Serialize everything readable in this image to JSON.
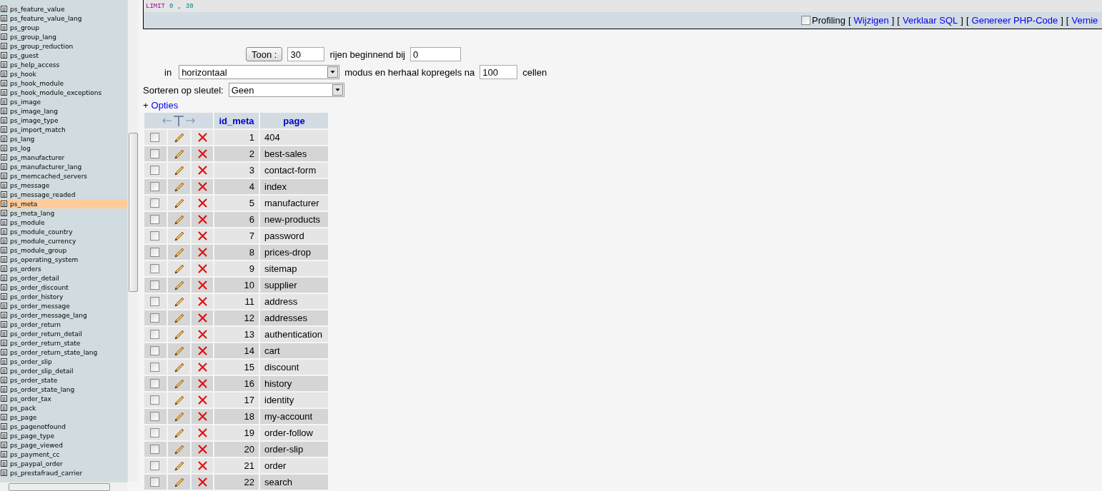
{
  "sidebar": {
    "tables": [
      {
        "name": "ps_feature_value",
        "selected": false
      },
      {
        "name": "ps_feature_value_lang",
        "selected": false
      },
      {
        "name": "ps_group",
        "selected": false
      },
      {
        "name": "ps_group_lang",
        "selected": false
      },
      {
        "name": "ps_group_reduction",
        "selected": false
      },
      {
        "name": "ps_guest",
        "selected": false
      },
      {
        "name": "ps_help_access",
        "selected": false
      },
      {
        "name": "ps_hook",
        "selected": false
      },
      {
        "name": "ps_hook_module",
        "selected": false
      },
      {
        "name": "ps_hook_module_exceptions",
        "selected": false
      },
      {
        "name": "ps_image",
        "selected": false
      },
      {
        "name": "ps_image_lang",
        "selected": false
      },
      {
        "name": "ps_image_type",
        "selected": false
      },
      {
        "name": "ps_import_match",
        "selected": false
      },
      {
        "name": "ps_lang",
        "selected": false
      },
      {
        "name": "ps_log",
        "selected": false
      },
      {
        "name": "ps_manufacturer",
        "selected": false
      },
      {
        "name": "ps_manufacturer_lang",
        "selected": false
      },
      {
        "name": "ps_memcached_servers",
        "selected": false
      },
      {
        "name": "ps_message",
        "selected": false
      },
      {
        "name": "ps_message_readed",
        "selected": false
      },
      {
        "name": "ps_meta",
        "selected": true
      },
      {
        "name": "ps_meta_lang",
        "selected": false
      },
      {
        "name": "ps_module",
        "selected": false
      },
      {
        "name": "ps_module_country",
        "selected": false
      },
      {
        "name": "ps_module_currency",
        "selected": false
      },
      {
        "name": "ps_module_group",
        "selected": false
      },
      {
        "name": "ps_operating_system",
        "selected": false
      },
      {
        "name": "ps_orders",
        "selected": false
      },
      {
        "name": "ps_order_detail",
        "selected": false
      },
      {
        "name": "ps_order_discount",
        "selected": false
      },
      {
        "name": "ps_order_history",
        "selected": false
      },
      {
        "name": "ps_order_message",
        "selected": false
      },
      {
        "name": "ps_order_message_lang",
        "selected": false
      },
      {
        "name": "ps_order_return",
        "selected": false
      },
      {
        "name": "ps_order_return_detail",
        "selected": false
      },
      {
        "name": "ps_order_return_state",
        "selected": false
      },
      {
        "name": "ps_order_return_state_lang",
        "selected": false
      },
      {
        "name": "ps_order_slip",
        "selected": false
      },
      {
        "name": "ps_order_slip_detail",
        "selected": false
      },
      {
        "name": "ps_order_state",
        "selected": false
      },
      {
        "name": "ps_order_state_lang",
        "selected": false
      },
      {
        "name": "ps_order_tax",
        "selected": false
      },
      {
        "name": "ps_pack",
        "selected": false
      },
      {
        "name": "ps_page",
        "selected": false
      },
      {
        "name": "ps_pagenotfound",
        "selected": false
      },
      {
        "name": "ps_page_type",
        "selected": false
      },
      {
        "name": "ps_page_viewed",
        "selected": false
      },
      {
        "name": "ps_payment_cc",
        "selected": false
      },
      {
        "name": "ps_paypal_order",
        "selected": false
      },
      {
        "name": "ps_prestafraud_carrier",
        "selected": false
      }
    ]
  },
  "sql": {
    "tokens": [
      {
        "text": "LIMIT",
        "kind": "keyword"
      },
      {
        "text": "0",
        "kind": "number"
      },
      {
        "text": ",",
        "kind": "punct"
      },
      {
        "text": "30",
        "kind": "number"
      }
    ],
    "profiling": {
      "label": "Profiling",
      "checked": false
    },
    "links": [
      {
        "open": "[",
        "label": "Wijzigen",
        "close": "]",
        "kind": "link"
      },
      {
        "open": "[",
        "label": "Verklaar SQL",
        "close": "]",
        "kind": "link"
      },
      {
        "open": "[",
        "label": "Genereer PHP-Code",
        "close": "]",
        "kind": "link"
      },
      {
        "open": "[",
        "label": "Vernie",
        "kind": "link"
      }
    ]
  },
  "navigation": {
    "show_button": "Toon :",
    "rows_value": "30",
    "rows_label": "rijen beginnend bij",
    "start_value": "0",
    "in_label": "in",
    "mode_value": "horizontaal",
    "repeat_label": "modus en herhaal kopregels na",
    "repeat_value": "100",
    "cells_label": "cellen",
    "sort_label": "Sorteren op sleutel:",
    "sort_value": "Geen",
    "options_prefix": "+",
    "options_link": "Opties"
  },
  "table": {
    "columns": [
      "id_meta",
      "page"
    ],
    "rows": [
      {
        "checked": false,
        "id_meta": "1",
        "page": "404"
      },
      {
        "checked": false,
        "id_meta": "2",
        "page": "best-sales"
      },
      {
        "checked": false,
        "id_meta": "3",
        "page": "contact-form"
      },
      {
        "checked": false,
        "id_meta": "4",
        "page": "index"
      },
      {
        "checked": false,
        "id_meta": "5",
        "page": "manufacturer"
      },
      {
        "checked": false,
        "id_meta": "6",
        "page": "new-products"
      },
      {
        "checked": false,
        "id_meta": "7",
        "page": "password"
      },
      {
        "checked": false,
        "id_meta": "8",
        "page": "prices-drop"
      },
      {
        "checked": false,
        "id_meta": "9",
        "page": "sitemap"
      },
      {
        "checked": false,
        "id_meta": "10",
        "page": "supplier"
      },
      {
        "checked": false,
        "id_meta": "11",
        "page": "address"
      },
      {
        "checked": false,
        "id_meta": "12",
        "page": "addresses"
      },
      {
        "checked": false,
        "id_meta": "13",
        "page": "authentication"
      },
      {
        "checked": false,
        "id_meta": "14",
        "page": "cart"
      },
      {
        "checked": false,
        "id_meta": "15",
        "page": "discount"
      },
      {
        "checked": false,
        "id_meta": "16",
        "page": "history"
      },
      {
        "checked": false,
        "id_meta": "17",
        "page": "identity"
      },
      {
        "checked": false,
        "id_meta": "18",
        "page": "my-account"
      },
      {
        "checked": false,
        "id_meta": "19",
        "page": "order-follow"
      },
      {
        "checked": false,
        "id_meta": "20",
        "page": "order-slip"
      },
      {
        "checked": false,
        "id_meta": "21",
        "page": "order"
      },
      {
        "checked": false,
        "id_meta": "22",
        "page": "search"
      }
    ]
  }
}
